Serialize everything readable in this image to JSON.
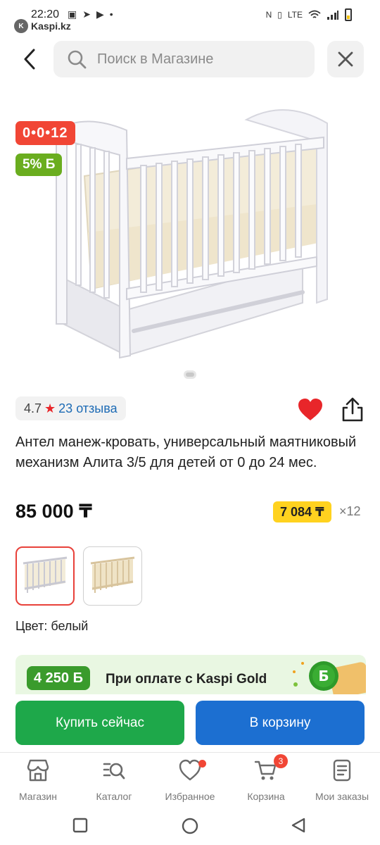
{
  "status_bar": {
    "time": "22:20",
    "app_name": "Kaspi.kz",
    "app_logo_letter": "K",
    "network": "LTE"
  },
  "search": {
    "placeholder": "Поиск в Магазине"
  },
  "product": {
    "installment_badge": "0•0•12",
    "bonus_badge": "5% Б",
    "rating": "4.7",
    "reviews": "23 отзыва",
    "title": "Антел манеж-кровать, универсальный маятниковый механизм Алита 3/5 для детей от 0 до 24 мес.",
    "price": "85 000 ₸",
    "installment_price": "7 084 ₸",
    "installment_multiplier": "×12",
    "color_label": "Цвет: белый",
    "color_options": [
      "white",
      "beige"
    ],
    "selected_color_index": 0
  },
  "kaspi_gold": {
    "bonus": "4 250 Б",
    "text": "При оплате с Kaspi Gold"
  },
  "actions": {
    "buy_now": "Купить сейчас",
    "add_to_cart": "В корзину"
  },
  "bottom_nav": {
    "items": [
      {
        "label": "Магазин",
        "icon": "shop-icon"
      },
      {
        "label": "Каталог",
        "icon": "catalog-icon"
      },
      {
        "label": "Избранное",
        "icon": "heart-icon"
      },
      {
        "label": "Корзина",
        "icon": "cart-icon",
        "badge": "3"
      },
      {
        "label": "Мои заказы",
        "icon": "orders-icon"
      }
    ]
  },
  "colors": {
    "accent_red": "#f14635",
    "buy_green": "#1ea84a",
    "cart_blue": "#1c6fd1",
    "installment_yellow": "#ffd21f",
    "bonus_green": "#6aad1f"
  }
}
